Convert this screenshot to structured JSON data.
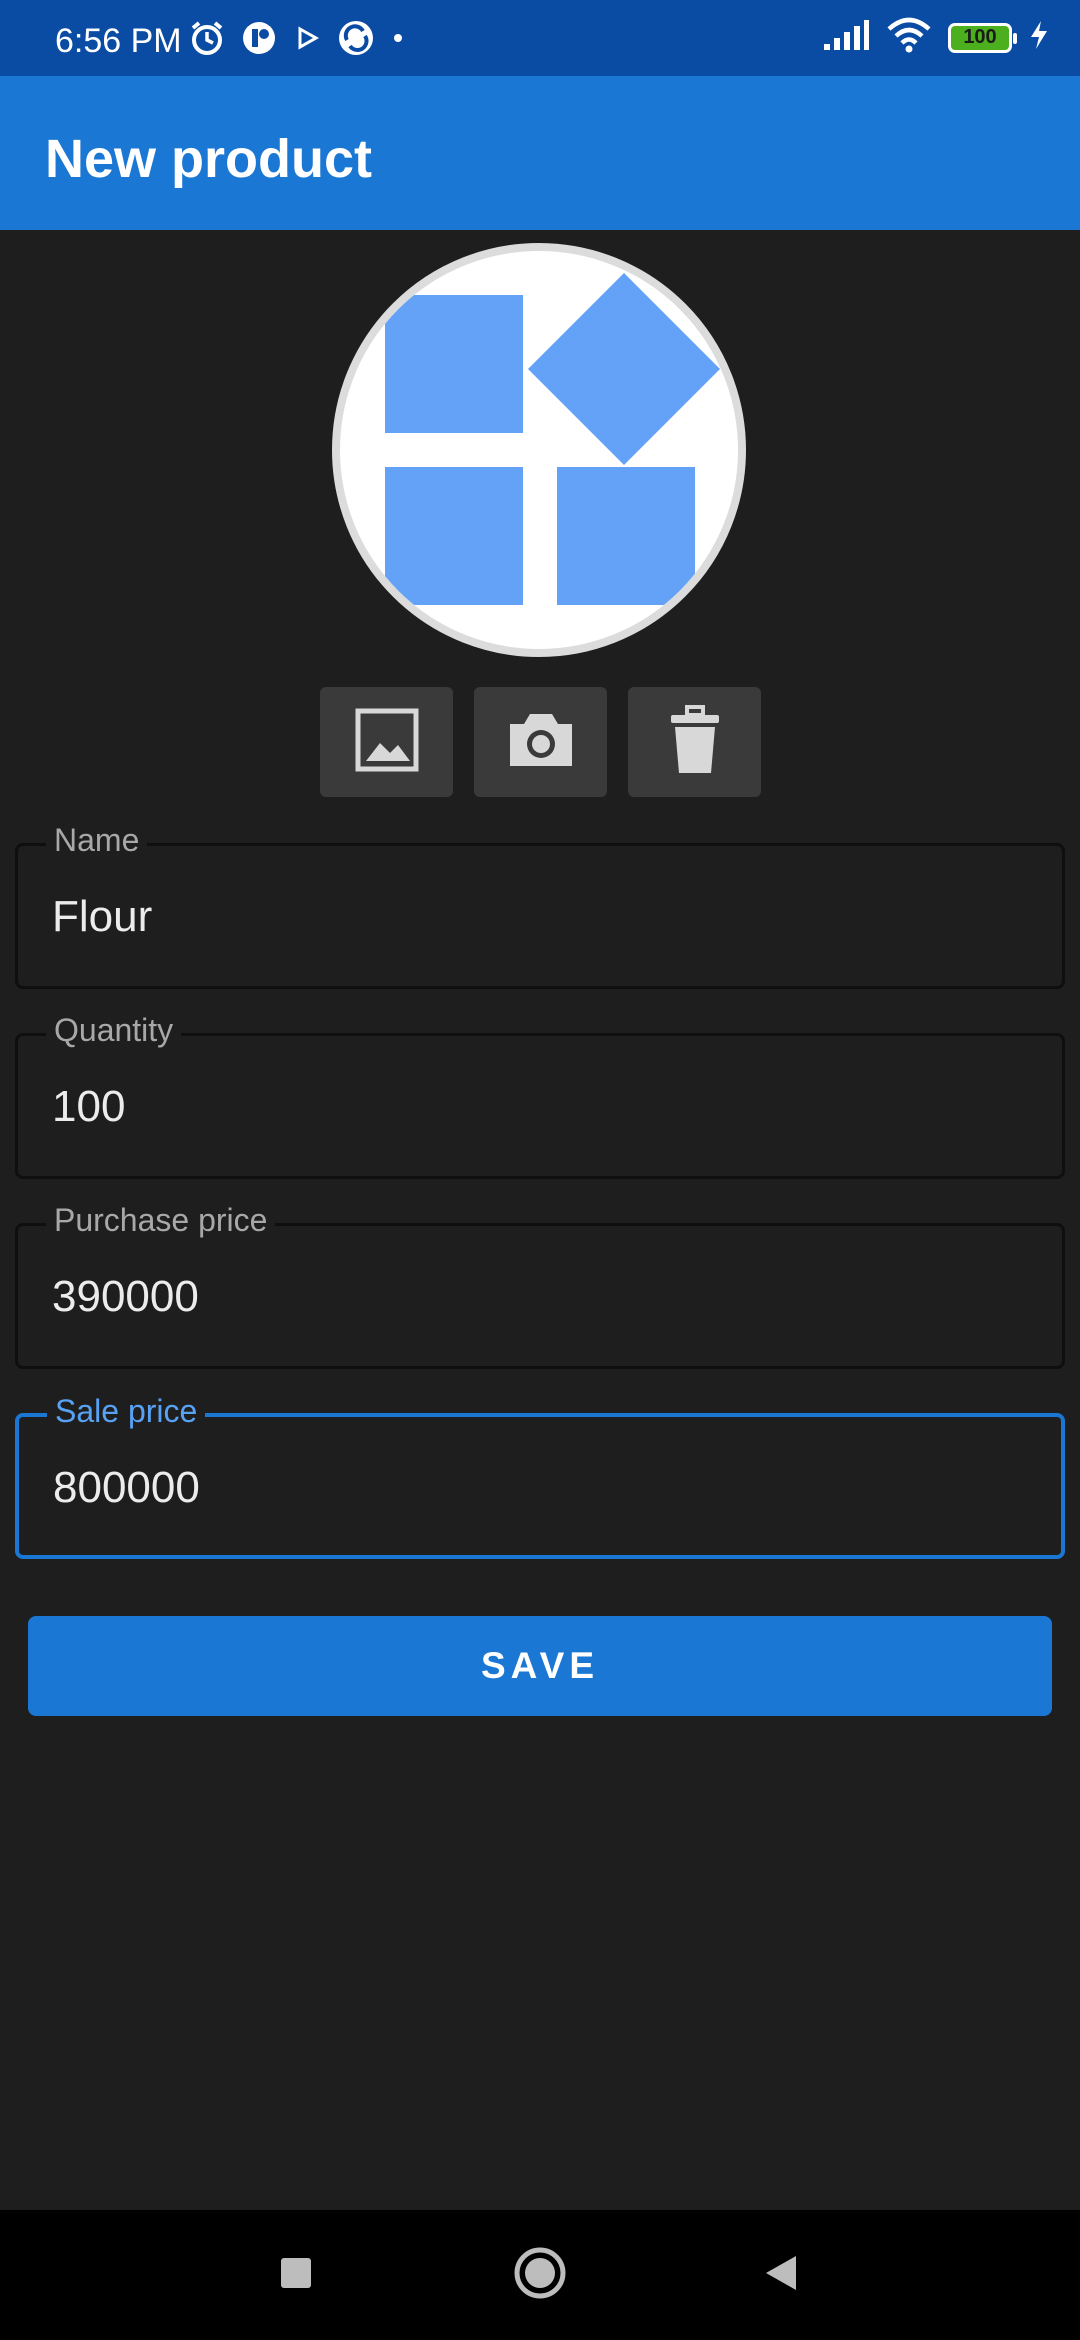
{
  "status_bar": {
    "time": "6:56 PM",
    "battery": "100",
    "icons": [
      "alarm-icon",
      "app-notification-icon",
      "play-icon",
      "sync-app-icon",
      "dot-icon",
      "signal-icon",
      "wifi-icon",
      "battery-icon",
      "charging-icon"
    ]
  },
  "app_bar": {
    "title": "New product"
  },
  "image_actions": [
    "gallery-icon",
    "camera-icon",
    "delete-icon"
  ],
  "form": {
    "name": {
      "label": "Name",
      "value": "Flour"
    },
    "quantity": {
      "label": "Quantity",
      "value": "100"
    },
    "purchase_price": {
      "label": "Purchase price",
      "value": "390000"
    },
    "sale_price": {
      "label": "Sale price",
      "value": "800000"
    }
  },
  "save_label": "SAVE",
  "colors": {
    "status_bar": "#0a4ba3",
    "app_bar": "#1a77d4",
    "background": "#1e1e1e",
    "accent": "#1a77d4",
    "placeholder_tiles": "#64a2f7"
  }
}
